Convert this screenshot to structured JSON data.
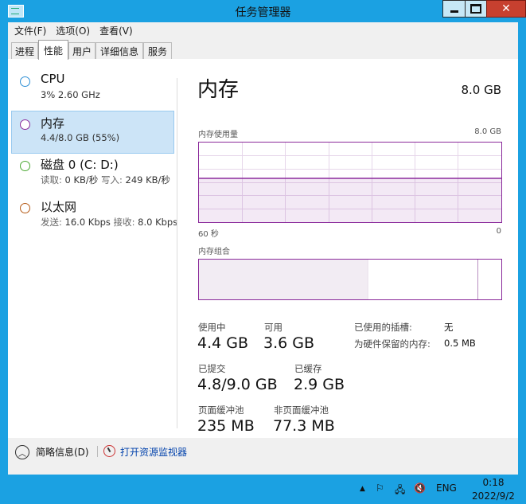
{
  "window": {
    "title": "任务管理器"
  },
  "menu": {
    "file": "文件(F)",
    "options": "选项(O)",
    "view": "查看(V)"
  },
  "tabs": [
    {
      "label": "进程"
    },
    {
      "label": "性能"
    },
    {
      "label": "用户"
    },
    {
      "label": "详细信息"
    },
    {
      "label": "服务"
    }
  ],
  "sidebar": [
    {
      "title": "CPU",
      "sub": "3% 2.60 GHz",
      "color": "#2d8fd5"
    },
    {
      "title": "内存",
      "sub": "4.4/8.0 GB (55%)",
      "color": "#8b2b9b"
    },
    {
      "title": "磁盘 0 (C: D:)",
      "sub_label1": "读取:",
      "sub_val1": "0 KB/秒",
      "sub_label2": "写入:",
      "sub_val2": "249 KB/秒",
      "color": "#4aa832"
    },
    {
      "title": "以太网",
      "sub_label1": "发送:",
      "sub_val1": "16.0 Kbps",
      "sub_label2": "接收:",
      "sub_val2": "8.0 Kbps",
      "color": "#b55a16"
    }
  ],
  "memory": {
    "title": "内存",
    "total": "8.0 GB",
    "usage_label": "内存使用量",
    "usage_max": "8.0 GB",
    "time_left": "60 秒",
    "time_right": "0",
    "composition_label": "内存组合",
    "in_use_fraction": 0.55,
    "stats": {
      "in_use_label": "使用中",
      "in_use": "4.4 GB",
      "available_label": "可用",
      "available": "3.6 GB",
      "committed_label": "已提交",
      "committed": "4.8/9.0 GB",
      "cached_label": "已缓存",
      "cached": "2.9 GB",
      "paged_label": "页面缓冲池",
      "paged": "235 MB",
      "nonpaged_label": "非页面缓冲池",
      "nonpaged": "77.3 MB",
      "slots_label": "已使用的插槽:",
      "slots": "无",
      "reserved_label": "为硬件保留的内存:",
      "reserved": "0.5 MB"
    }
  },
  "footer": {
    "brief": "简略信息(D)",
    "monitor_link": "打开资源监视器"
  },
  "taskbar": {
    "lang": "ENG",
    "time": "0:18",
    "date": "2022/9/2"
  }
}
